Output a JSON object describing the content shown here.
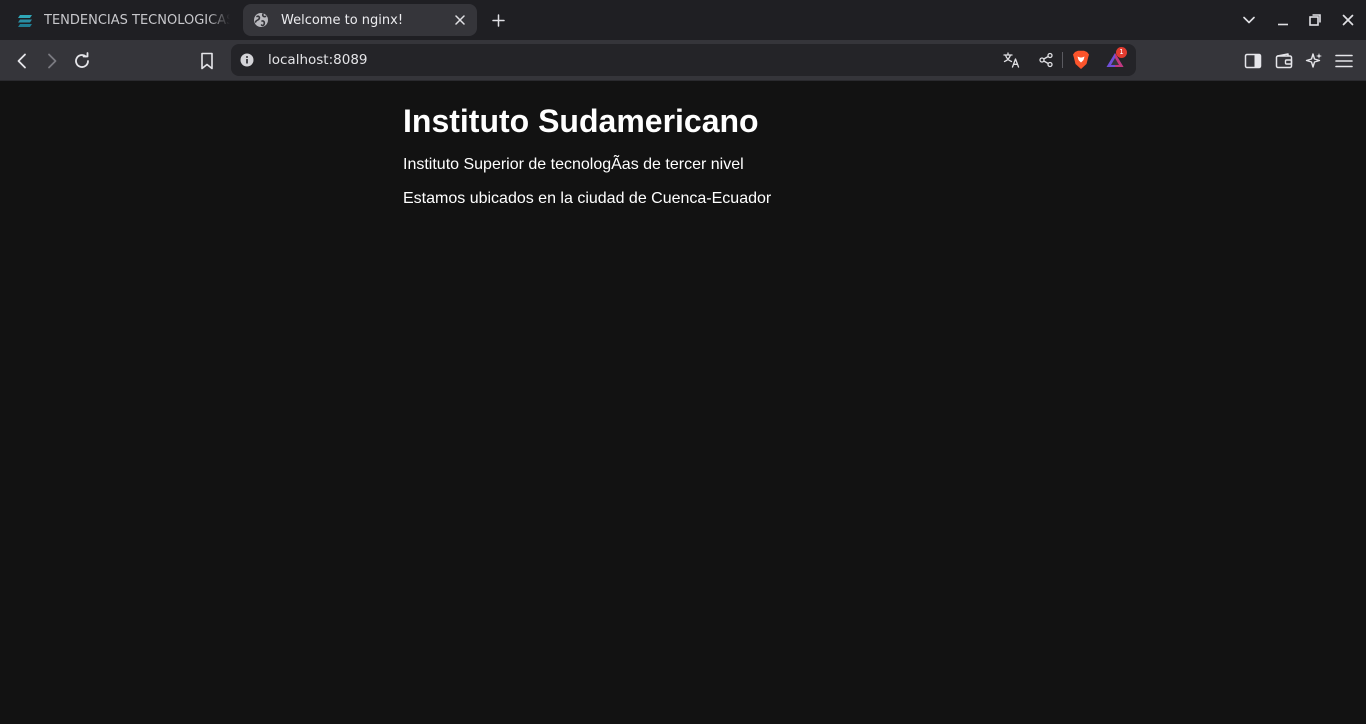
{
  "tabs": [
    {
      "title": "TENDENCIAS TECNOLOGICAS -",
      "active": false,
      "favicon": "stack-logo-icon"
    },
    {
      "title": "Welcome to nginx!",
      "active": true,
      "favicon": "globe-icon"
    }
  ],
  "toolbar": {
    "url": "localhost:8089",
    "rewards_badge": "1"
  },
  "page": {
    "heading": "Instituto Sudamericano",
    "paragraph_1": "Instituto Superior de tecnologÃas de tercer nivel",
    "paragraph_2": "Estamos ubicados en la ciudad de Cuenca-Ecuador"
  },
  "colors": {
    "tabstrip_bg": "#1f1f23",
    "toolbar_bg": "#35353a",
    "omnibox_bg": "#242428",
    "page_bg": "#121212",
    "brave_orange": "#fb542b",
    "badge_red": "#e23b2f"
  }
}
